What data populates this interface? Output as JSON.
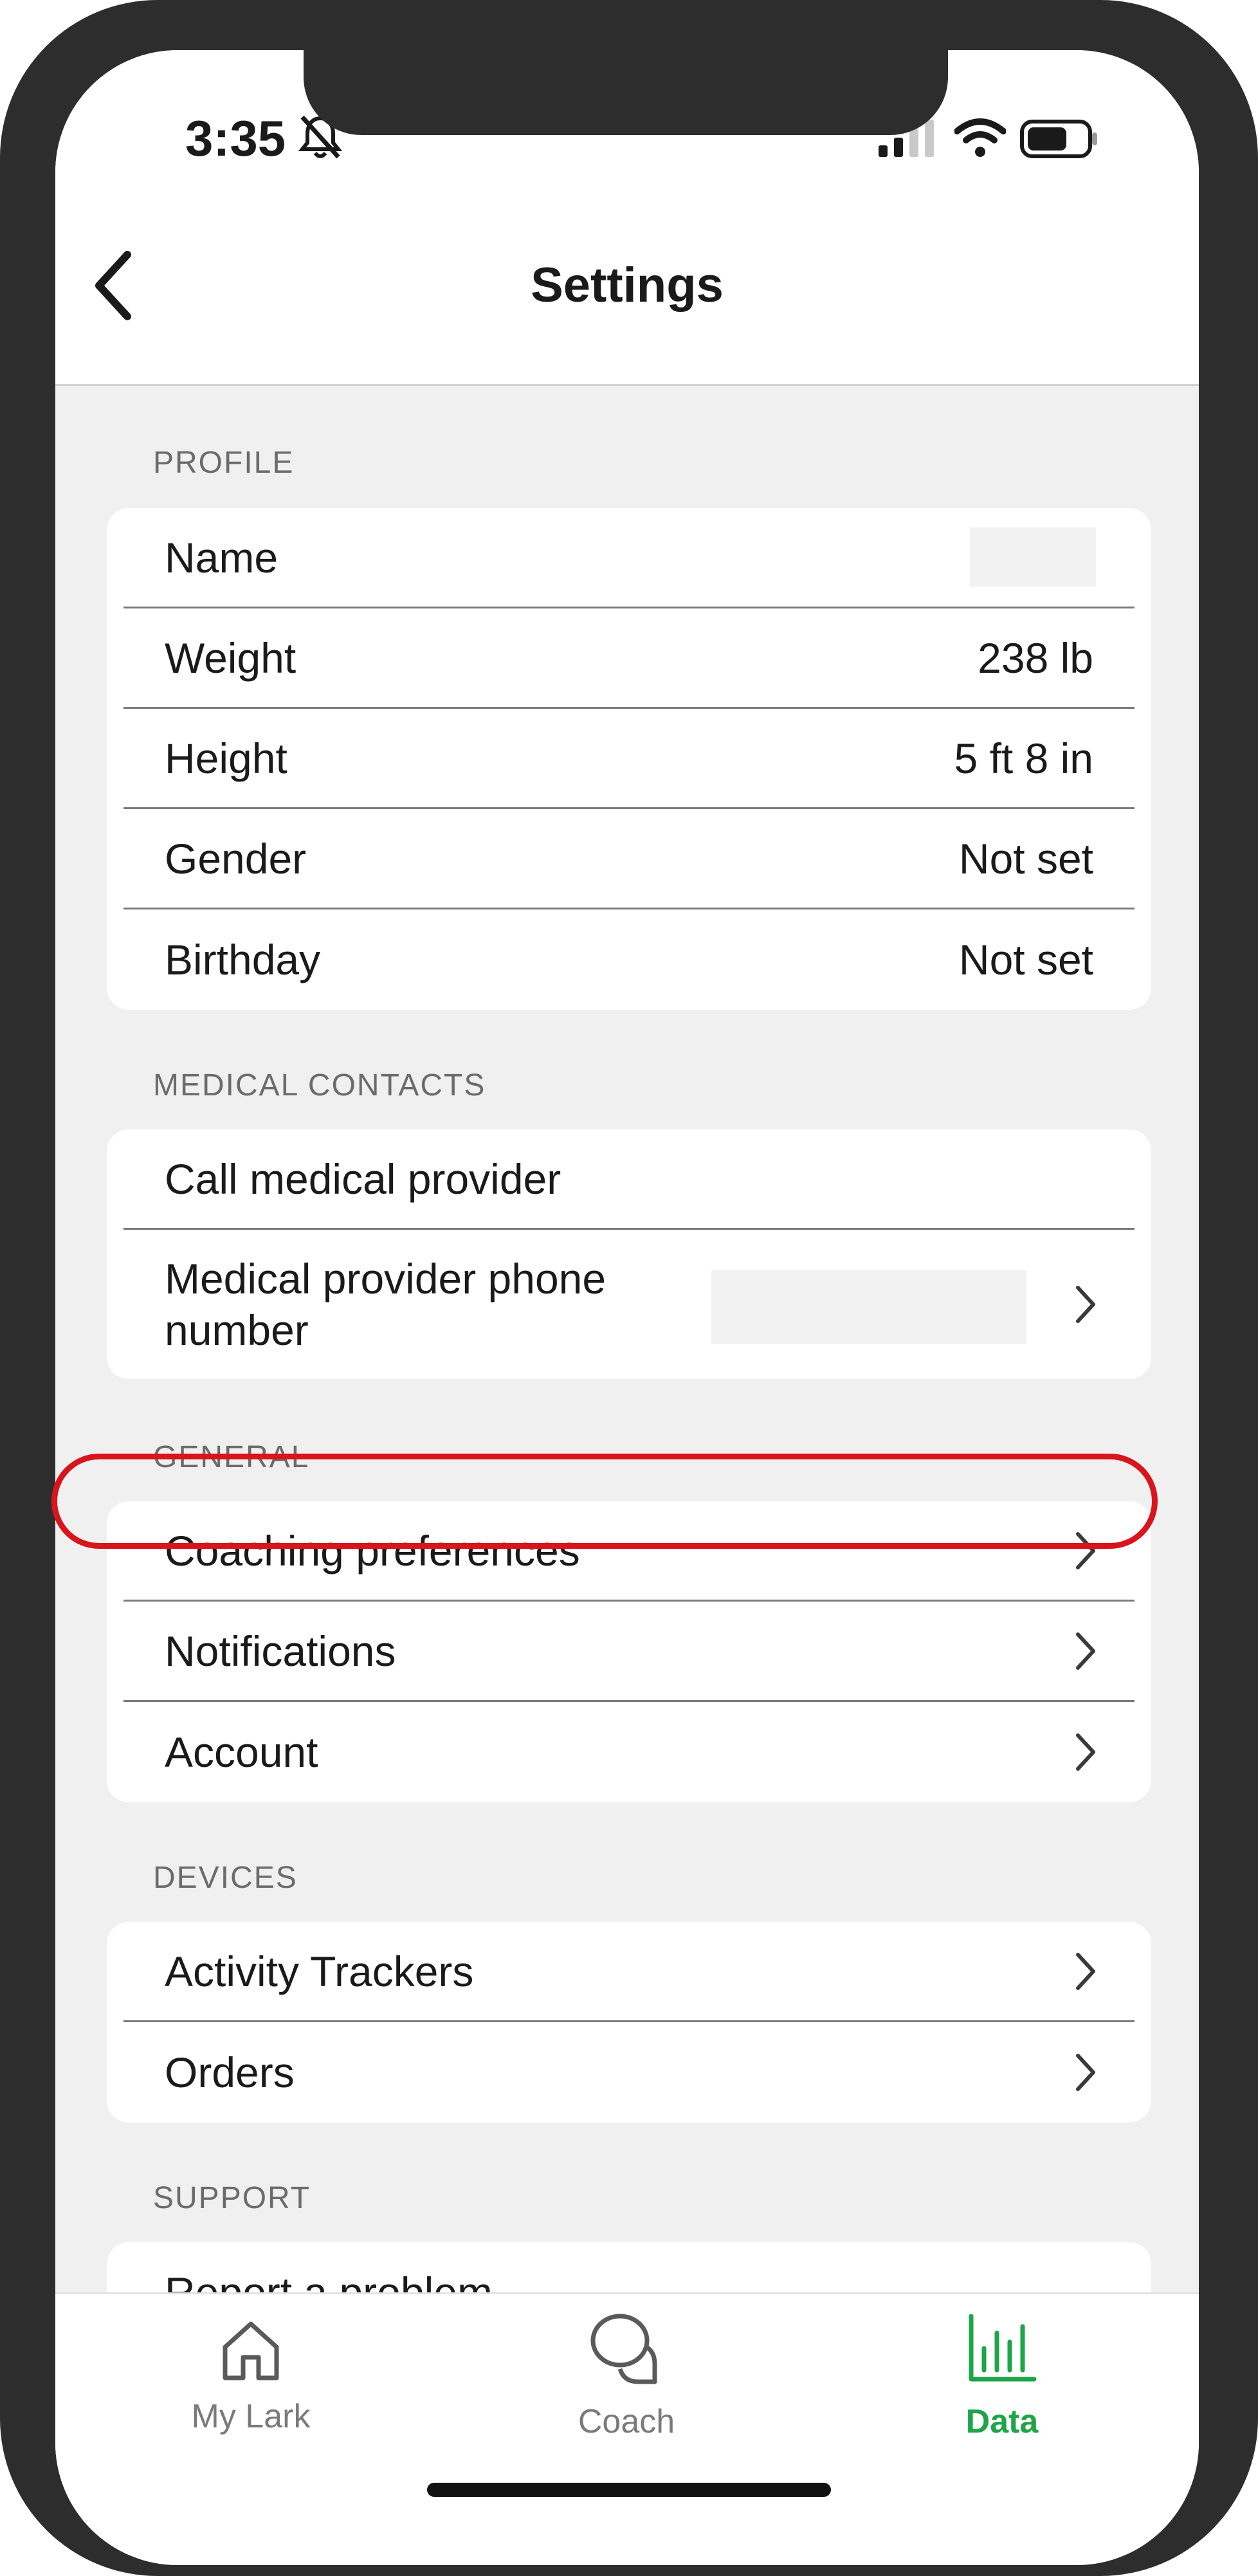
{
  "status_bar": {
    "time": "3:35"
  },
  "header": {
    "title": "Settings"
  },
  "sections": {
    "profile": {
      "header": "PROFILE",
      "rows": [
        {
          "label": "Name",
          "value": ""
        },
        {
          "label": "Weight",
          "value": "238 lb"
        },
        {
          "label": "Height",
          "value": "5 ft 8 in"
        },
        {
          "label": "Gender",
          "value": "Not set"
        },
        {
          "label": "Birthday",
          "value": "Not set"
        }
      ]
    },
    "medical": {
      "header": "MEDICAL CONTACTS",
      "rows": [
        {
          "label": "Call medical provider"
        },
        {
          "label": "Medical provider phone number"
        }
      ]
    },
    "general": {
      "header": "GENERAL",
      "rows": [
        {
          "label": "Coaching preferences"
        },
        {
          "label": "Notifications"
        },
        {
          "label": "Account"
        }
      ]
    },
    "devices": {
      "header": "DEVICES",
      "rows": [
        {
          "label": "Activity Trackers"
        },
        {
          "label": "Orders"
        }
      ]
    },
    "support": {
      "header": "SUPPORT",
      "rows": [
        {
          "label": "Report a problem"
        }
      ]
    }
  },
  "tabs": [
    {
      "label": "My Lark",
      "icon": "home-icon"
    },
    {
      "label": "Coach",
      "icon": "chat-bubbles-icon"
    },
    {
      "label": "Data",
      "icon": "bar-chart-icon",
      "active": true
    }
  ],
  "colors": {
    "accent": "#1fa447",
    "highlight": "#d8141c",
    "background": "#f0f0f0"
  }
}
